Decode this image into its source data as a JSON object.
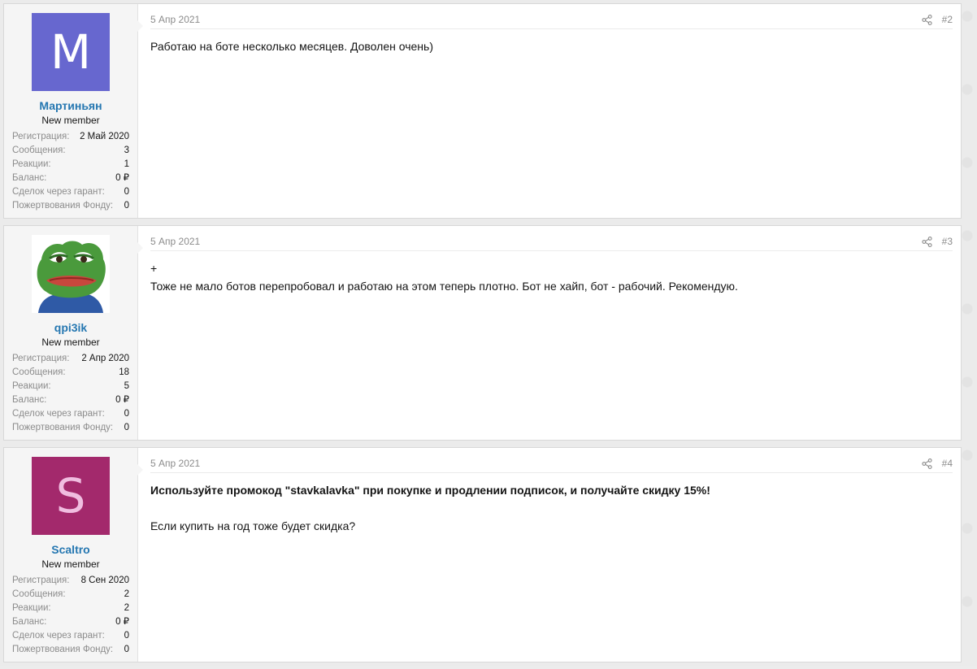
{
  "posts": [
    {
      "avatar": {
        "letter": "M",
        "bg": "#6767cf"
      },
      "username": "Мартиньян",
      "usertitle": "New member",
      "stats": [
        {
          "key": "Регистрация:",
          "val": "2 Май 2020"
        },
        {
          "key": "Сообщения:",
          "val": "3"
        },
        {
          "key": "Реакции:",
          "val": "1"
        },
        {
          "key": "Баланс:",
          "val": "0 ₽"
        },
        {
          "key": "Сделок через гарант:",
          "val": "0"
        },
        {
          "key": "Пожертвования Фонду:",
          "val": "0"
        }
      ],
      "date": "5 Апр 2021",
      "number": "#2",
      "lines": [
        "Работаю на боте несколько месяцев. Доволен очень)"
      ]
    },
    {
      "avatar": {
        "image": "pepe-frog-avatar"
      },
      "username": "qpi3ik",
      "usertitle": "New member",
      "stats": [
        {
          "key": "Регистрация:",
          "val": "2 Апр 2020"
        },
        {
          "key": "Сообщения:",
          "val": "18"
        },
        {
          "key": "Реакции:",
          "val": "5"
        },
        {
          "key": "Баланс:",
          "val": "0 ₽"
        },
        {
          "key": "Сделок через гарант:",
          "val": "0"
        },
        {
          "key": "Пожертвования Фонду:",
          "val": "0"
        }
      ],
      "date": "5 Апр 2021",
      "number": "#3",
      "lines": [
        "+",
        "Тоже не мало ботов перепробовал и работаю на этом теперь плотно. Бот не хайп, бот - рабочий. Рекомендую."
      ]
    },
    {
      "avatar": {
        "letter": "S",
        "bg": "#a3296c"
      },
      "username": "Scaltro",
      "usertitle": "New member",
      "stats": [
        {
          "key": "Регистрация:",
          "val": "8 Сен 2020"
        },
        {
          "key": "Сообщения:",
          "val": "2"
        },
        {
          "key": "Реакции:",
          "val": "2"
        },
        {
          "key": "Баланс:",
          "val": "0 ₽"
        },
        {
          "key": "Сделок через гарант:",
          "val": "0"
        },
        {
          "key": "Пожертвования Фонду:",
          "val": "0"
        }
      ],
      "date": "5 Апр 2021",
      "number": "#4",
      "bold_line": "Используйте промокод \"stavkalavka\" при покупке и продлении подписок, и получайте скидку 15%!",
      "lines": [
        "Если купить на год тоже будет скидка?"
      ]
    }
  ]
}
